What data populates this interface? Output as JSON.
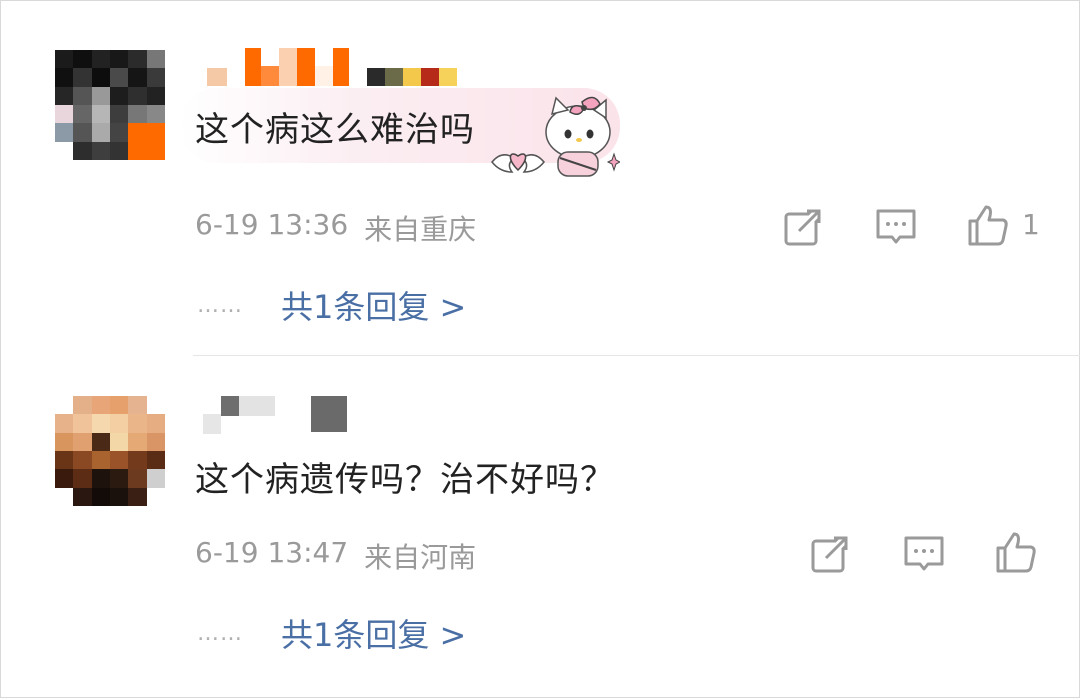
{
  "comments": [
    {
      "text": "这个病这么难治吗",
      "time": "6-19 13:36",
      "location": "来自重庆",
      "like_count": "1",
      "replies_label": "共1条回复 >",
      "ellipsis": "……",
      "sticker_icon": "hello-kitty-sticker-icon"
    },
    {
      "text": "这个病遗传吗？治不好吗？",
      "time": "6-19 13:47",
      "location": "来自河南",
      "like_count": "",
      "replies_label": "共1条回复 >",
      "ellipsis": "……"
    }
  ],
  "icons": [
    "share-icon",
    "comment-icon",
    "like-icon"
  ],
  "colors": {
    "text": "#222222",
    "meta": "#9a9a9a",
    "link": "#4a6fa5",
    "bubble": "#fbe3ea"
  }
}
